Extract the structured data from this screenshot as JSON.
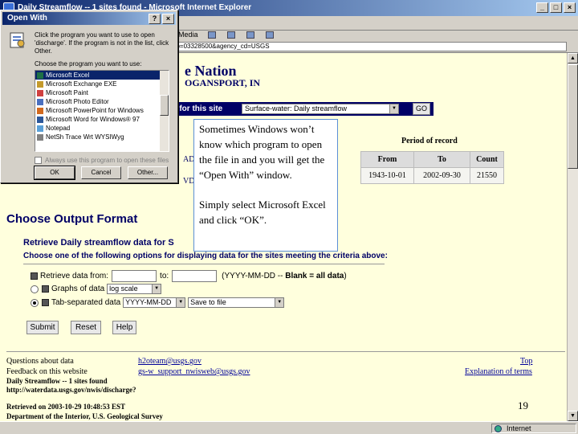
{
  "browser": {
    "title": "Daily Streamflow -- 1 sites found - Microsoft Internet Explorer",
    "toolbar_media": "Media",
    "address_fragment": "no=03328500&agency_cd=USGS",
    "status_zone": "Internet"
  },
  "page": {
    "heading_fragment": "e Nation",
    "location_fragment": "OGANSPORT, IN",
    "data_bar_label": "data for this site",
    "data_select_value": "Surface-water: Daily streamflow",
    "go_label": "GO",
    "frag_ad": "AD2",
    "frag_vd": "VD29",
    "period": {
      "title": "Period of record",
      "headers": [
        "From",
        "To",
        "Count"
      ],
      "row": [
        "1943-10-01",
        "2002-09-30",
        "21550"
      ]
    },
    "output": {
      "heading": "Choose Output Format",
      "subheading_fragment": "Retrieve Daily streamflow data for S",
      "instructions": "Choose one of the following options for displaying data for the sites meeting the criteria above:",
      "retrieve_from_label": "Retrieve data from:",
      "to_label": "to:",
      "date_hint_prefix": "(YYYY-MM-DD --",
      "date_hint_bold": "Blank = all data",
      "date_hint_suffix": ")",
      "graphs_label": "Graphs of data",
      "graphs_select": "log scale",
      "tab_label": "Tab-separated data",
      "tab_date_select": "YYYY-MM-DD",
      "tab_dest_select": "Save to file",
      "submit": "Submit",
      "reset": "Reset",
      "help": "Help"
    },
    "footer": {
      "questions_label": "Questions about data",
      "questions_email": "h2oteam@usgs.gov",
      "feedback_label": "Feedback on this website",
      "feedback_email": "gs-w_support_nwisweb@usgs.gov",
      "top_link": "Top",
      "explanation_link": "Explanation of terms",
      "page_name": "Daily Streamflow -- 1 sites found",
      "url": "http://waterdata.usgs.gov/nwis/discharge?",
      "retrieved": "Retrieved on 2003-10-29 10:48:53 EST",
      "department": "Department of the Interior, U.S. Geological Survey"
    },
    "slide_number": "19"
  },
  "dialog": {
    "title": "Open With",
    "description": "Click the program you want to use to open 'discharge'. If the program is not in the list, click Other.",
    "choose_label": "Choose the program you want to use:",
    "programs": [
      {
        "label": "Microsoft Excel",
        "color": "#1e7145"
      },
      {
        "label": "Microsoft Exchange EXE",
        "color": "#c49a2c"
      },
      {
        "label": "Microsoft Paint",
        "color": "#d04040"
      },
      {
        "label": "Microsoft Photo Editor",
        "color": "#4a70c0"
      },
      {
        "label": "Microsoft PowerPoint for Windows",
        "color": "#d2691e"
      },
      {
        "label": "Microsoft Word for Windows® 97",
        "color": "#2b579a"
      },
      {
        "label": "Notepad",
        "color": "#5aa0d8"
      },
      {
        "label": "NetSh Trace Wrt WYSIWyg",
        "color": "#808080"
      }
    ],
    "always_use": "Always use this program to open these files",
    "ok": "OK",
    "cancel": "Cancel",
    "other": "Other..."
  },
  "callout": {
    "paragraph1": "Sometimes Windows won’t know which program to open the file in and you will get the “Open With” window.",
    "paragraph2": "Simply select Microsoft Excel and click “OK”."
  }
}
